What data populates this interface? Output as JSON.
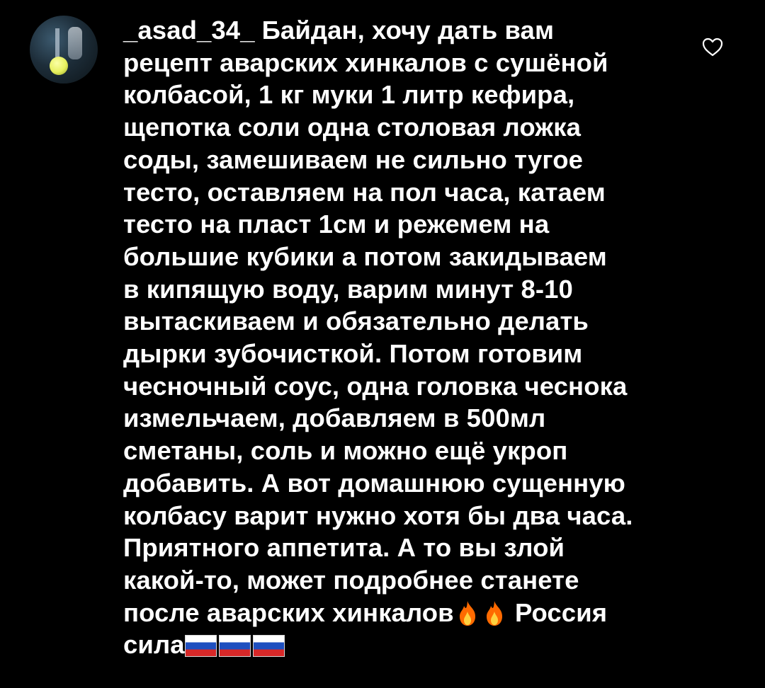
{
  "comment": {
    "username": "_asad_34_",
    "text_lines": [
      "Байдан, хочу дать вам",
      "рецепт аварских хинкалов с сушёной",
      "колбасой, 1 кг муки 1 литр кефира,",
      "щепотка соли одна столовая ложка",
      "соды, замешиваем не сильно тугое",
      "тесто, оставляем на пол часа,  катаем",
      "тесто на пласт 1см и режемем на",
      "большие кубики а потом закидываем",
      "в кипящую воду, варим минут 8-10",
      "вытаскиваем и обязательно делать",
      "дырки зубочисткой. Потом готовим",
      "чесночный соус, одна головка чеснока",
      "измельчаем, добавляем в 500мл",
      "сметаны, соль и можно ещё укроп",
      "добавить. А вот домашнюю сущенную",
      "колбасу варит нужно хотя бы два часа.",
      "Приятного аппетита. А то вы злой",
      "какой-то, может подробнее станете",
      "после аварских хинкалов",
      "Россия",
      "сила"
    ],
    "emoji": {
      "fire": "fire-emoji",
      "flag": "russia-flag-emoji"
    },
    "icons": {
      "like": "heart-outline-icon"
    }
  },
  "colors": {
    "background": "#000000",
    "text": "#ffffff",
    "icon": "#ffffff"
  }
}
